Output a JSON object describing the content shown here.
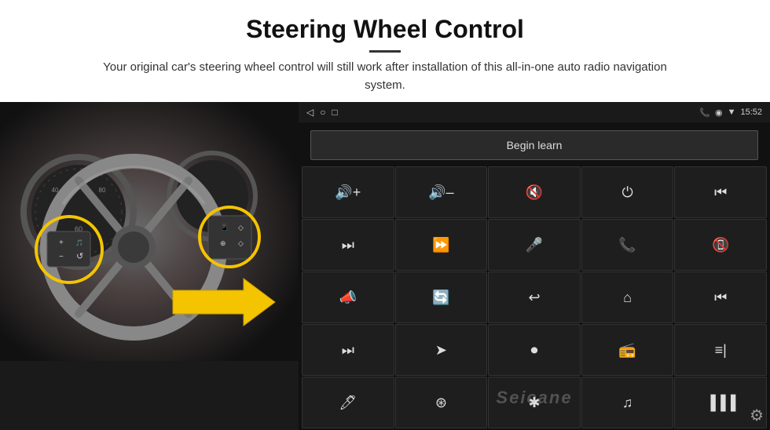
{
  "header": {
    "title": "Steering Wheel Control",
    "subtitle": "Your original car's steering wheel control will still work after installation of this all-in-one auto radio navigation system."
  },
  "topbar": {
    "time": "15:52",
    "icons": [
      "◁",
      "○",
      "□",
      "📶"
    ]
  },
  "begin_learn": {
    "label": "Begin learn"
  },
  "grid_icons": [
    {
      "symbol": "🔊+",
      "name": "vol-up"
    },
    {
      "symbol": "🔊−",
      "name": "vol-down"
    },
    {
      "symbol": "🔇",
      "name": "mute"
    },
    {
      "symbol": "⏻",
      "name": "power"
    },
    {
      "symbol": "⏮",
      "name": "prev-track"
    },
    {
      "symbol": "⏭",
      "name": "next-track"
    },
    {
      "symbol": "⏩",
      "name": "fast-forward"
    },
    {
      "symbol": "🎤",
      "name": "mic"
    },
    {
      "symbol": "📞",
      "name": "call"
    },
    {
      "symbol": "↩",
      "name": "hang-up"
    },
    {
      "symbol": "📢",
      "name": "speaker"
    },
    {
      "symbol": "360°",
      "name": "camera-360"
    },
    {
      "symbol": "↺",
      "name": "back"
    },
    {
      "symbol": "🏠",
      "name": "home"
    },
    {
      "symbol": "⏮⏮",
      "name": "prev"
    },
    {
      "symbol": "⏭",
      "name": "next2"
    },
    {
      "symbol": "➤",
      "name": "nav"
    },
    {
      "symbol": "⏺",
      "name": "source"
    },
    {
      "symbol": "📻",
      "name": "radio"
    },
    {
      "symbol": "⚙",
      "name": "eq"
    },
    {
      "symbol": "🎤",
      "name": "mic2"
    },
    {
      "symbol": "⊙",
      "name": "menu"
    },
    {
      "symbol": "✱",
      "name": "bluetooth"
    },
    {
      "symbol": "🎵",
      "name": "music"
    },
    {
      "symbol": "|||",
      "name": "spectrum"
    }
  ],
  "watermark": "Seicane",
  "settings": {
    "icon": "⚙"
  }
}
